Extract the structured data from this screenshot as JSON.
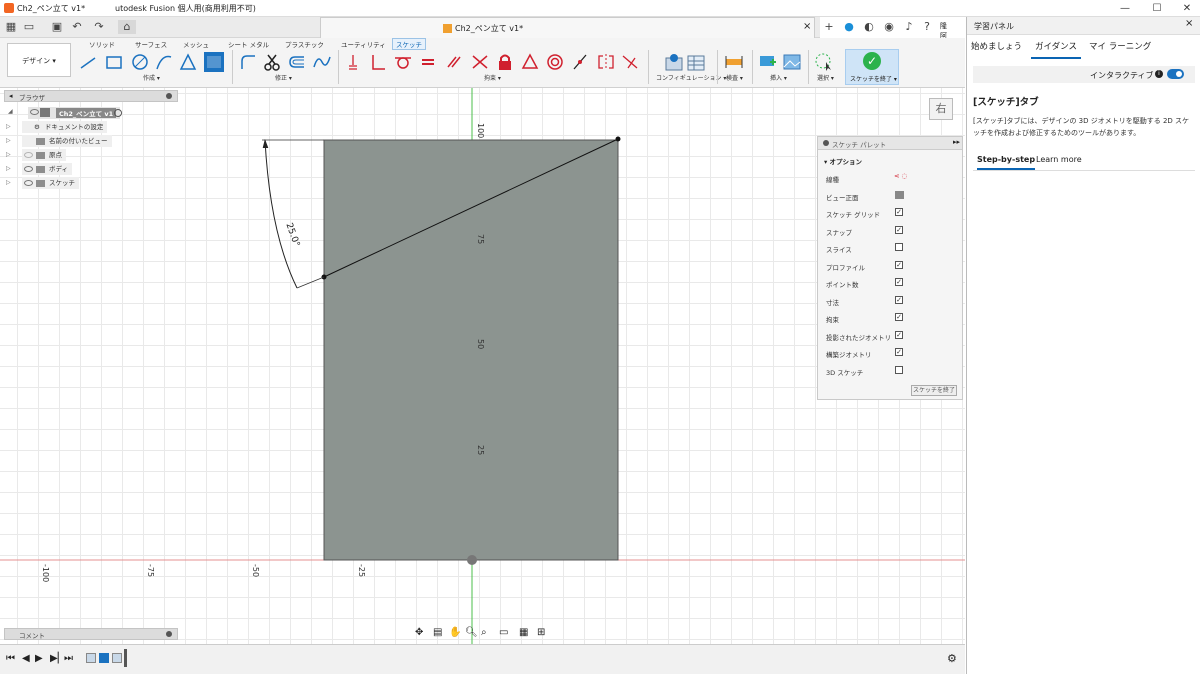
{
  "window": {
    "title": "Ch2_ペン立て v1*",
    "app_title": "utodesk Fusion 個人用(商用利用不可)",
    "minimize": "—",
    "maximize": "☐",
    "close": "✕"
  },
  "document_tab": {
    "label": "Ch2_ペン立て v1*"
  },
  "user": {
    "initials": "隆阿"
  },
  "ribbon": {
    "design_button": "デザイン ▾",
    "tabs": [
      "ソリッド",
      "サーフェス",
      "メッシュ",
      "シート メタル",
      "プラスチック",
      "ユーティリティ",
      "スケッチ"
    ],
    "active_tab": "スケッチ",
    "groups": {
      "create": "作成 ▾",
      "modify": "修正 ▾",
      "constraints": "拘束 ▾",
      "configure": "コンフィギュレーション ▾",
      "inspect": "検査 ▾",
      "insert": "挿入 ▾",
      "select": "選択 ▾",
      "finish": "スケッチを終了 ▾"
    }
  },
  "browser": {
    "title": "ブラウザ",
    "root": "Ch2_ペン立て v1",
    "items": [
      "ドキュメントの設定",
      "名前の付いたビュー",
      "原点",
      "ボディ",
      "スケッチ"
    ]
  },
  "viewcube": {
    "face": "右"
  },
  "canvas": {
    "dimension": "25.0°",
    "vertical_ticks": [
      "100",
      "75",
      "50",
      "25"
    ],
    "horizontal_ticks": [
      "-100",
      "-75",
      "-50",
      "-25"
    ]
  },
  "sketch_palette": {
    "title": "スケッチ パレット",
    "section": "オプション",
    "rows": [
      {
        "label": "線種",
        "type": "icons"
      },
      {
        "label": "ビュー正面",
        "type": "icon"
      },
      {
        "label": "スケッチ グリッド",
        "checked": true
      },
      {
        "label": "スナップ",
        "checked": true
      },
      {
        "label": "スライス",
        "checked": false
      },
      {
        "label": "プロファイル",
        "checked": true
      },
      {
        "label": "ポイント数",
        "checked": true
      },
      {
        "label": "寸法",
        "checked": true
      },
      {
        "label": "拘束",
        "checked": true
      },
      {
        "label": "投影されたジオメトリ",
        "checked": true
      },
      {
        "label": "構築ジオメトリ",
        "checked": true
      },
      {
        "label": "3D スケッチ",
        "checked": false
      }
    ],
    "finish_button": "スケッチを終了"
  },
  "learning_panel": {
    "title": "学習パネル",
    "tabs": [
      "始めましょう",
      "ガイダンス",
      "マイ ラーニング"
    ],
    "active_tab": "ガイダンス",
    "interactive_label": "インタラクティブ",
    "heading": "[スケッチ]タブ",
    "body": "[スケッチ]タブには、デザインの 3D ジオメトリを駆動する 2D スケッチを作成および修正するためのツールがあります。",
    "subtabs": [
      "Step-by-step",
      "Learn more"
    ],
    "active_subtab": "Step-by-step"
  },
  "comments": {
    "label": "コメント"
  },
  "colors": {
    "accent": "#0a64b3",
    "finish_green": "#2bb24c",
    "sketch_red": "#d0202e",
    "body_fill": "#8c9490"
  }
}
